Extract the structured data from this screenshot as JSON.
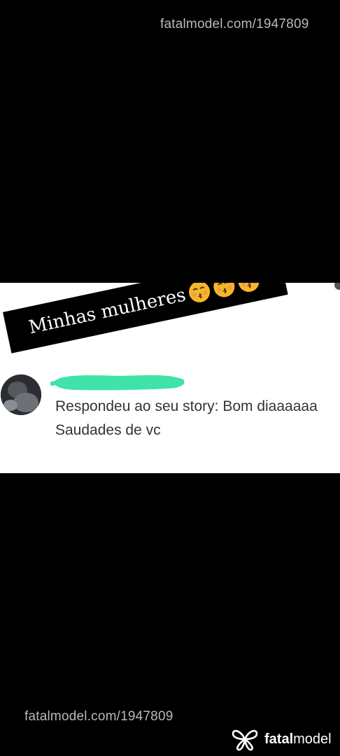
{
  "watermarks": {
    "top": "fatalmodel.com/1947809",
    "bottom": "fatalmodel.com/1947809"
  },
  "sticker": {
    "text": "Minhas mulheres",
    "emoji_count": 3,
    "emoji_icon": "kissing-face-emoji"
  },
  "notification": {
    "line1": "Respondeu ao seu story: Bom diaaaaaa",
    "line2": "Saudades de vc"
  },
  "brand": {
    "logo_icon": "fatalmodel-butterfly-logo",
    "name_bold": "fatal",
    "name_regular": "model"
  },
  "colors": {
    "background": "#000000",
    "card": "#ffffff",
    "redaction": "#3fe3a8",
    "watermark": "#b9b9b9",
    "emoji_face": "#f7b62b"
  }
}
